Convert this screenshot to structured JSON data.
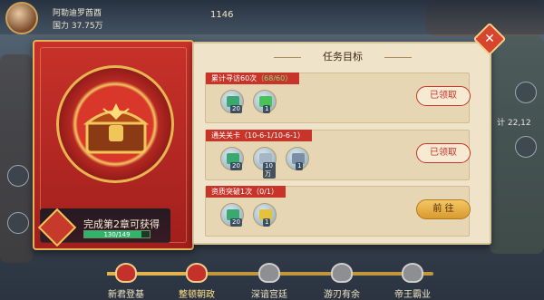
{
  "hud": {
    "player_name": "阿勒迪罗酋酉",
    "power": "国力 37.75万",
    "gold": "1146",
    "timer": "计 22,12"
  },
  "left_card": {
    "reward_text": "完成第2章可获得",
    "progress_text": "130/149",
    "progress_fraction": 0.872
  },
  "panel": {
    "title": "任务目标",
    "close_label": "✕",
    "tasks": [
      {
        "label": "累计寻访60次",
        "count": "（68/60）",
        "button": "已领取",
        "items": [
          {
            "icon": "book-icon",
            "qty": "20",
            "color": "#3aa870"
          },
          {
            "icon": "scroll-icon",
            "qty": "1",
            "color": "#4ac25a"
          }
        ]
      },
      {
        "label": "通关关卡",
        "count": "（10-6-1/10-6-1）",
        "button": "已领取",
        "items": [
          {
            "icon": "book-icon",
            "qty": "20",
            "color": "#3aa870"
          },
          {
            "icon": "silver-icon",
            "qty": "10万",
            "color": "#a7b6c6"
          },
          {
            "icon": "token-icon",
            "qty": "1",
            "color": "#7a8ea6"
          }
        ]
      },
      {
        "label": "资质突破1次",
        "count": "（0/1）",
        "button": "前 往",
        "items": [
          {
            "icon": "book-icon",
            "qty": "20",
            "color": "#3aa870"
          },
          {
            "icon": "gold-ingot-icon",
            "qty": "1",
            "color": "#e6c23a"
          }
        ]
      }
    ]
  },
  "chapters": [
    {
      "name": "新君登基",
      "state": "done"
    },
    {
      "name": "整顿朝政",
      "state": "current"
    },
    {
      "name": "深谙宫廷",
      "state": "locked"
    },
    {
      "name": "游刃有余",
      "state": "locked"
    },
    {
      "name": "帝王霸业",
      "state": "locked"
    }
  ],
  "colors": {
    "accent_red": "#c7342a",
    "panel_bg": "#efe3c9",
    "gold": "#e3b35c",
    "progress_green": "#2fb56a"
  }
}
